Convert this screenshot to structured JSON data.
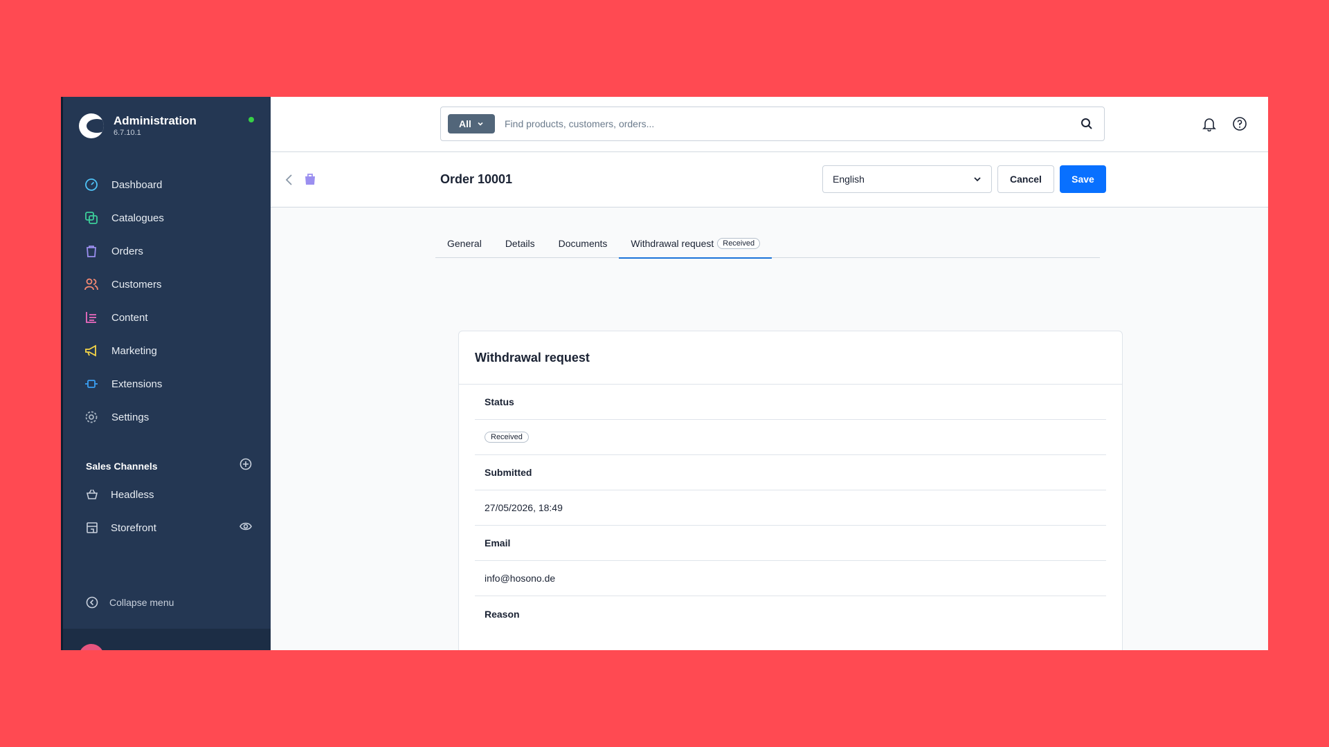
{
  "app": {
    "title": "Administration",
    "version": "6.7.10.1"
  },
  "nav": {
    "items": [
      {
        "label": "Dashboard",
        "icon": "dashboard-icon"
      },
      {
        "label": "Catalogues",
        "icon": "catalogues-icon"
      },
      {
        "label": "Orders",
        "icon": "orders-icon"
      },
      {
        "label": "Customers",
        "icon": "customers-icon"
      },
      {
        "label": "Content",
        "icon": "content-icon"
      },
      {
        "label": "Marketing",
        "icon": "marketing-icon"
      },
      {
        "label": "Extensions",
        "icon": "extensions-icon"
      },
      {
        "label": "Settings",
        "icon": "settings-icon"
      }
    ],
    "sales_channels_title": "Sales Channels",
    "sales_channels": [
      {
        "label": "Headless"
      },
      {
        "label": "Storefront"
      }
    ],
    "collapse_label": "Collapse menu"
  },
  "search": {
    "type_label": "All",
    "placeholder": "Find products, customers, orders..."
  },
  "smartbar": {
    "title": "Order 10001",
    "language": "English",
    "cancel_label": "Cancel",
    "save_label": "Save"
  },
  "tabs": [
    {
      "label": "General"
    },
    {
      "label": "Details"
    },
    {
      "label": "Documents"
    },
    {
      "label": "Withdrawal request",
      "badge": "Received"
    }
  ],
  "card": {
    "title": "Withdrawal request",
    "fields": {
      "status_label": "Status",
      "status_value": "Received",
      "submitted_label": "Submitted",
      "submitted_value": "27/05/2026, 18:49",
      "email_label": "Email",
      "email_value": "info@hosono.de",
      "reason_label": "Reason"
    }
  },
  "colors": {
    "background": "#ff4a52",
    "sidebar": "#243753",
    "primary": "#0870ff",
    "status_online": "#37d046"
  }
}
